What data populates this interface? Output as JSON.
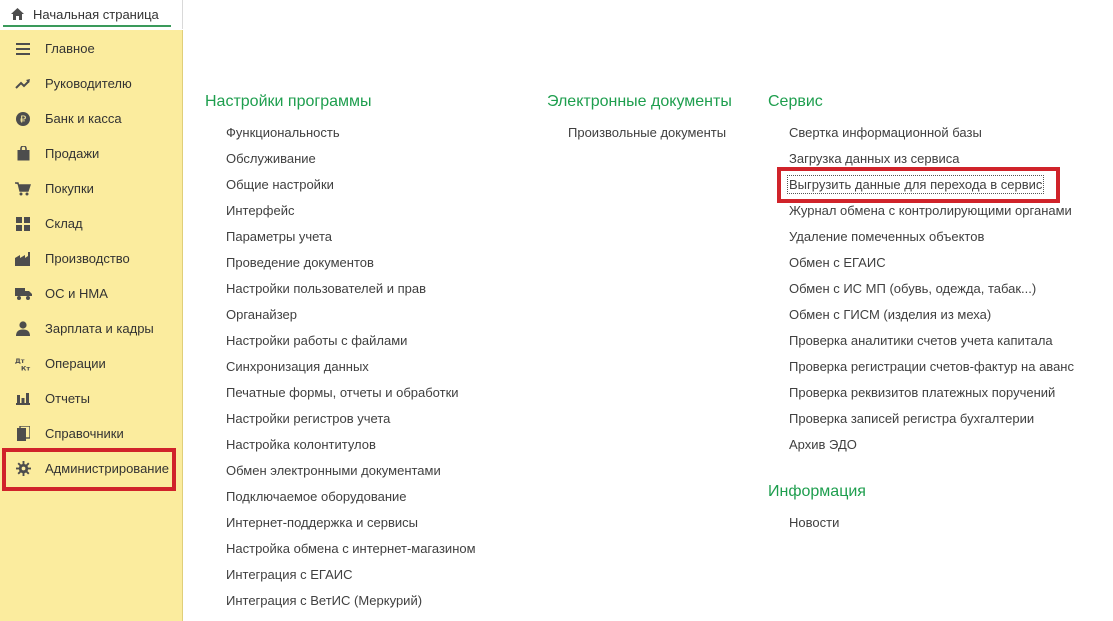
{
  "home_tab": {
    "label": "Начальная страница",
    "icon": "home-icon"
  },
  "sidebar": {
    "items": [
      {
        "label": "Главное",
        "icon": "menu-lines-icon"
      },
      {
        "label": "Руководителю",
        "icon": "trend-up-icon"
      },
      {
        "label": "Банк и касса",
        "icon": "ruble-coin-icon"
      },
      {
        "label": "Продажи",
        "icon": "shopping-bag-icon"
      },
      {
        "label": "Покупки",
        "icon": "cart-icon"
      },
      {
        "label": "Склад",
        "icon": "warehouse-grid-icon"
      },
      {
        "label": "Производство",
        "icon": "factory-icon"
      },
      {
        "label": "ОС и НМА",
        "icon": "truck-icon"
      },
      {
        "label": "Зарплата и кадры",
        "icon": "person-icon"
      },
      {
        "label": "Операции",
        "icon": "debit-credit-icon",
        "icon_text": "Дт Кт"
      },
      {
        "label": "Отчеты",
        "icon": "bar-chart-icon"
      },
      {
        "label": "Справочники",
        "icon": "books-icon"
      },
      {
        "label": "Администрирование",
        "icon": "gear-icon",
        "highlighted": true
      }
    ]
  },
  "sections": {
    "settings": {
      "title": "Настройки программы",
      "links": [
        "Функциональность",
        "Обслуживание",
        "Общие настройки",
        "Интерфейс",
        "Параметры учета",
        "Проведение документов",
        "Настройки пользователей и прав",
        "Органайзер",
        "Настройки работы с файлами",
        "Синхронизация данных",
        "Печатные формы, отчеты и обработки",
        "Настройки регистров учета",
        "Настройка колонтитулов",
        "Обмен электронными документами",
        "Подключаемое оборудование",
        "Интернет-поддержка и сервисы",
        "Настройка обмена с интернет-магазином",
        "Интеграция с ЕГАИС",
        "Интеграция с ВетИС (Меркурий)"
      ]
    },
    "edocs": {
      "title": "Электронные документы",
      "links": [
        "Произвольные документы"
      ]
    },
    "service": {
      "title": "Сервис",
      "links": [
        "Свертка информационной базы",
        "Загрузка данных из сервиса",
        "Выгрузить данные для перехода в сервис",
        "Журнал обмена с контролирующими органами",
        "Удаление помеченных объектов",
        "Обмен с ЕГАИС",
        "Обмен с ИС МП (обувь, одежда, табак...)",
        "Обмен с ГИСМ (изделия из меха)",
        "Проверка аналитики счетов учета капитала",
        "Проверка регистрации счетов-фактур на аванс",
        "Проверка реквизитов платежных поручений",
        "Проверка записей регистра бухгалтерии",
        "Архив ЭДО"
      ],
      "highlighted_index": 2
    },
    "info": {
      "title": "Информация",
      "links": [
        "Новости"
      ]
    }
  },
  "colors": {
    "sidebar_bg": "#fbec9e",
    "section_title": "#1e9e4e",
    "highlight_red": "#d0232a",
    "tab_underline": "#3a9a5b"
  }
}
